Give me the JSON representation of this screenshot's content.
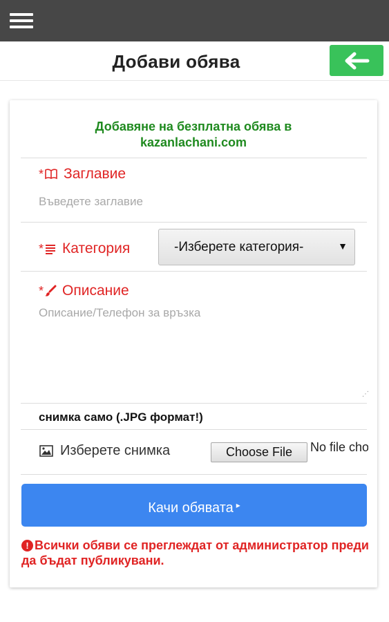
{
  "topbar": {
    "menu_icon": "hamburger-menu-icon",
    "background": "#474747"
  },
  "header": {
    "title": "Добави обява",
    "back_icon": "arrow-left-icon",
    "back_color": "#39c25a"
  },
  "form": {
    "intro_line1": "Добавяне на безплатна обява в",
    "intro_line2": "kazanlachani.com",
    "title_field": {
      "required_mark": "*",
      "icon": "book-icon",
      "label": "Заглавие",
      "placeholder": "Въведете заглавие"
    },
    "category_field": {
      "required_mark": "*",
      "icon": "list-icon",
      "label": "Категория",
      "selected": "-Изберете категория-",
      "arrow": "▼"
    },
    "description_field": {
      "required_mark": "*",
      "icon": "brush-icon",
      "label": "Описание",
      "placeholder": "Описание/Телефон за връзка"
    },
    "photo": {
      "note": "снимка само (.JPG формат!)",
      "icon": "image-icon",
      "label": "Изберете снимка",
      "choose_button": "Choose File",
      "no_file_text": "No file chosen"
    },
    "submit": {
      "label": "Качи обявата",
      "caret": "▸",
      "color": "#3c86f0"
    },
    "notice": {
      "icon": "exclamation-circle-icon",
      "glyph": "!",
      "text": "Всички обяви се преглеждат от администратор преди да бъдат публикувани."
    }
  }
}
